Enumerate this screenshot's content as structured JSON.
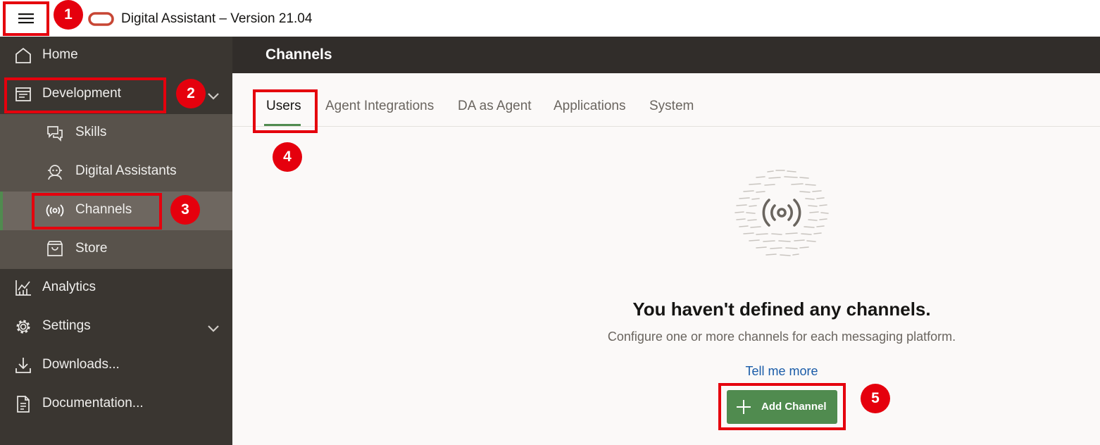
{
  "header": {
    "app_title": "Digital Assistant – Version 21.04",
    "menu_icon": "hamburger-menu-icon",
    "logo": "oracle-logo"
  },
  "sidebar": {
    "items": [
      {
        "label": "Home",
        "icon": "home-icon"
      },
      {
        "label": "Development",
        "icon": "development-icon",
        "expanded": true
      },
      {
        "label": "Analytics",
        "icon": "analytics-icon"
      },
      {
        "label": "Settings",
        "icon": "settings-icon"
      },
      {
        "label": "Downloads...",
        "icon": "download-icon"
      },
      {
        "label": "Documentation...",
        "icon": "documentation-icon"
      }
    ],
    "development_children": [
      {
        "label": "Skills",
        "icon": "skills-icon"
      },
      {
        "label": "Digital Assistants",
        "icon": "digital-assistant-icon"
      },
      {
        "label": "Channels",
        "icon": "channels-icon",
        "selected": true
      },
      {
        "label": "Store",
        "icon": "store-icon"
      }
    ]
  },
  "page": {
    "title": "Channels",
    "tabs": [
      {
        "label": "Users",
        "active": true
      },
      {
        "label": "Agent Integrations"
      },
      {
        "label": "DA as Agent"
      },
      {
        "label": "Applications"
      },
      {
        "label": "System"
      }
    ],
    "empty_state": {
      "title": "You haven't defined any channels.",
      "description": "Configure one or more channels for each messaging platform.",
      "link": "Tell me more",
      "button": "Add Channel"
    }
  },
  "annotations": [
    "1",
    "2",
    "3",
    "4",
    "5"
  ],
  "colors": {
    "accent_green": "#508b4f",
    "sidebar_bg": "#3a3631",
    "header_bg": "#312d2a",
    "annotation_red": "#e5000d",
    "link_blue": "#1a5ca8"
  }
}
